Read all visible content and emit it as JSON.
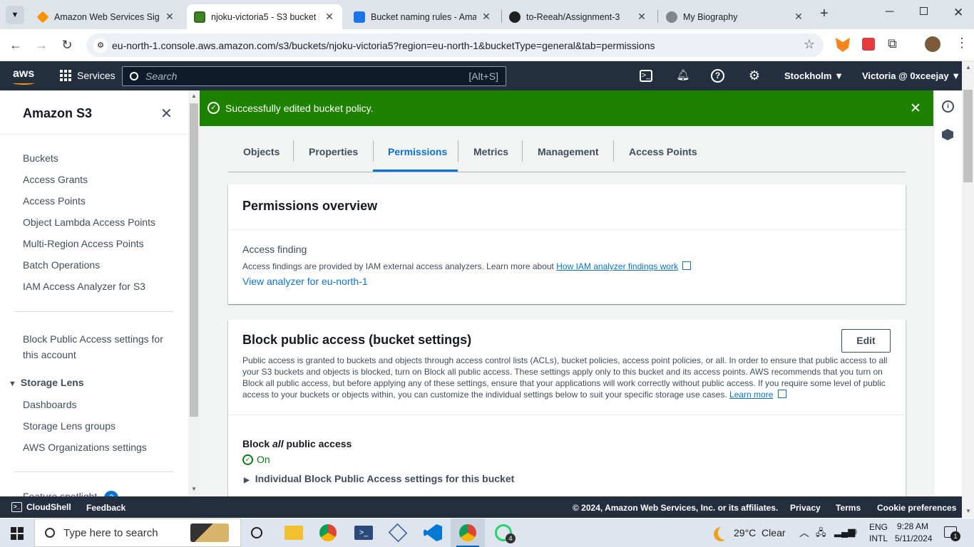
{
  "browser": {
    "tabs": [
      {
        "title": "Amazon Web Services Sign-In",
        "active": false
      },
      {
        "title": "njoku-victoria5 - S3 bucket |",
        "active": true
      },
      {
        "title": "Bucket naming rules - Amaz",
        "active": false
      },
      {
        "title": "to-Reeah/Assignment-3",
        "active": false
      },
      {
        "title": "My Biography",
        "active": false
      }
    ],
    "url": "eu-north-1.console.aws.amazon.com/s3/buckets/njoku-victoria5?region=eu-north-1&bucketType=general&tab=permissions"
  },
  "aws_header": {
    "logo": "aws",
    "services_label": "Services",
    "search_placeholder": "Search",
    "search_shortcut": "[Alt+S]",
    "region": "Stockholm",
    "account": "Victoria @ 0xceejay"
  },
  "sidenav": {
    "title": "Amazon S3",
    "items": [
      "Buckets",
      "Access Grants",
      "Access Points",
      "Object Lambda Access Points",
      "Multi-Region Access Points",
      "Batch Operations",
      "IAM Access Analyzer for S3"
    ],
    "block_public_line1": "Block Public Access settings for",
    "block_public_line2": "this account",
    "storage_lens": "Storage Lens",
    "storage_lens_items": [
      "Dashboards",
      "Storage Lens groups",
      "AWS Organizations settings"
    ],
    "feature_spotlight": "Feature spotlight",
    "feature_badge": "3"
  },
  "flash": {
    "message": "Successfully edited bucket policy."
  },
  "tabs": [
    "Objects",
    "Properties",
    "Permissions",
    "Metrics",
    "Management",
    "Access Points"
  ],
  "permissions_overview": {
    "title": "Permissions overview",
    "access_finding": "Access finding",
    "description": "Access findings are provided by IAM external access analyzers. Learn more about",
    "link": "How IAM analyzer findings work",
    "view_link": "View analyzer for eu-north-1"
  },
  "block_public_access": {
    "title": "Block public access (bucket settings)",
    "edit": "Edit",
    "description": "Public access is granted to buckets and objects through access control lists (ACLs), bucket policies, access point policies, or all. In order to ensure that public access to all your S3 buckets and objects is blocked, turn on Block all public access. These settings apply only to this bucket and its access points. AWS recommends that you turn on Block all public access, but before applying any of these settings, ensure that your applications will work correctly without public access. If you require some level of public access to your buckets or objects within, you can customize the individual settings below to suit your specific storage use cases.",
    "learn_more": "Learn more",
    "block_all_pre": "Block",
    "block_all_em": "all",
    "block_all_post": "public access",
    "status": "On",
    "individual": "Individual Block Public Access settings for this bucket"
  },
  "footer": {
    "cloudshell": "CloudShell",
    "feedback": "Feedback",
    "copyright": "© 2024, Amazon Web Services, Inc. or its affiliates.",
    "links": [
      "Privacy",
      "Terms",
      "Cookie preferences"
    ]
  },
  "taskbar": {
    "search_placeholder": "Type here to search",
    "weather": "29°C  Clear",
    "lang_top": "ENG",
    "lang_bottom": "INTL",
    "time": "9:28 AM",
    "date": "5/11/2024",
    "whatsapp_badge": "4",
    "notif_badge": "1"
  },
  "colors": {
    "aws_nav": "#232f3e",
    "flash_green": "#1d8102",
    "link": "#0972d3",
    "active_tab": "#0972d3",
    "status_green": "#037f0c"
  }
}
